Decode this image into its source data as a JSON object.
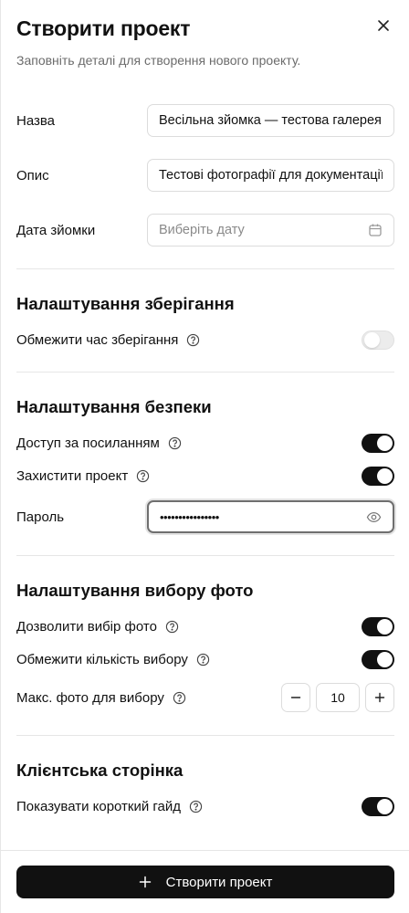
{
  "header": {
    "title": "Створити проект",
    "subtitle": "Заповніть деталі для створення нового проекту."
  },
  "fields": {
    "name": {
      "label": "Назва",
      "value": "Весільна зйомка — тестова галерея"
    },
    "description": {
      "label": "Опис",
      "value": "Тестові фотографії для документації"
    },
    "date": {
      "label": "Дата зйомки",
      "placeholder": "Виберіть дату",
      "icon": "calendar-icon"
    }
  },
  "storage": {
    "title": "Налаштування зберігання",
    "limit_time": {
      "label": "Обмежити час зберігання",
      "enabled": false
    }
  },
  "security": {
    "title": "Налаштування безпеки",
    "link_access": {
      "label": "Доступ за посиланням",
      "enabled": true
    },
    "protect": {
      "label": "Захистити проект",
      "enabled": true
    },
    "password": {
      "label": "Пароль",
      "value": "••••••••••••••••",
      "icon": "eye-icon"
    }
  },
  "selection": {
    "title": "Налаштування вибору фото",
    "allow": {
      "label": "Дозволити вибір фото",
      "enabled": true
    },
    "limit": {
      "label": "Обмежити кількість вибору",
      "enabled": true
    },
    "max": {
      "label": "Макс. фото для вибору",
      "value": "10"
    }
  },
  "client": {
    "title": "Клієнтська сторінка",
    "guide": {
      "label": "Показувати короткий гайд",
      "enabled": true
    }
  },
  "footer": {
    "create_label": "Створити проект"
  },
  "colors": {
    "accent": "#111111",
    "muted": "#6b6b6b",
    "border": "#dcdcdc"
  }
}
